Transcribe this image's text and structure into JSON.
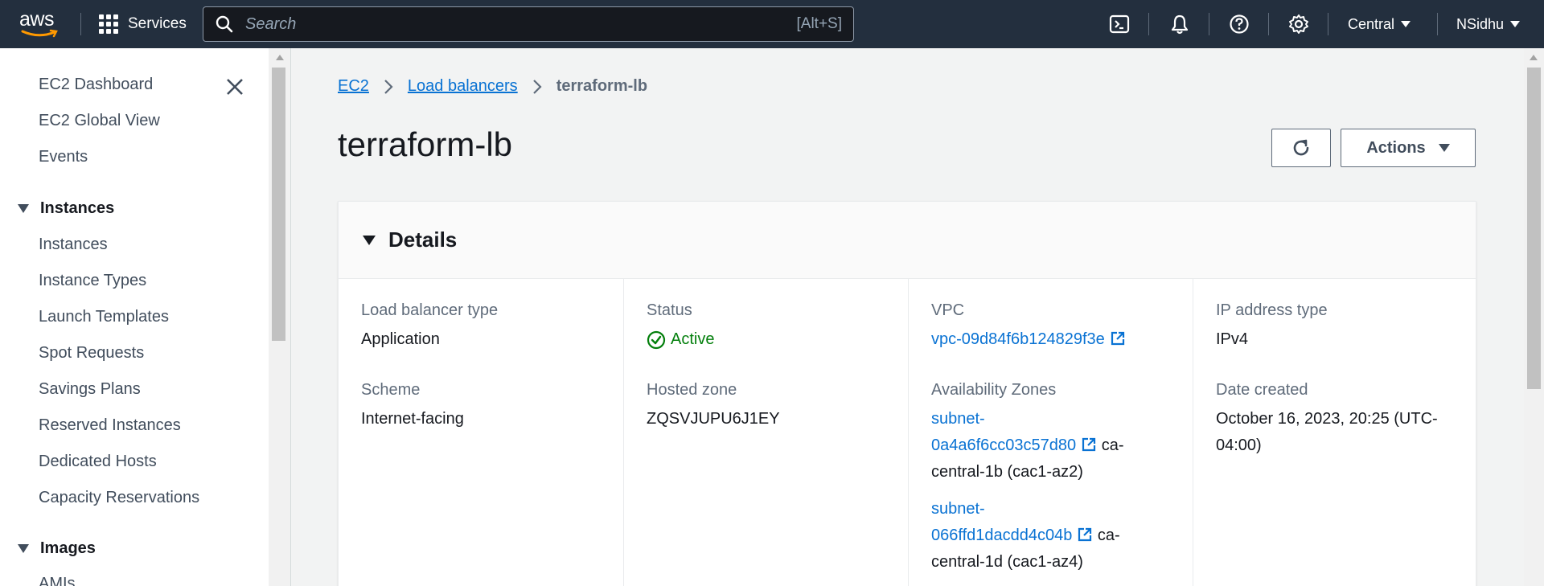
{
  "topnav": {
    "logo": "aws",
    "services_label": "Services",
    "search_placeholder": "Search",
    "search_shortcut": "[Alt+S]",
    "region": "Central",
    "user": "NSidhu"
  },
  "sidebar": {
    "items_top": [
      "EC2 Dashboard",
      "EC2 Global View",
      "Events"
    ],
    "section_instances": "Instances",
    "instances_items": [
      "Instances",
      "Instance Types",
      "Launch Templates",
      "Spot Requests",
      "Savings Plans",
      "Reserved Instances",
      "Dedicated Hosts",
      "Capacity Reservations"
    ],
    "section_images": "Images",
    "images_items": [
      "AMIs"
    ]
  },
  "breadcrumb": {
    "root": "EC2",
    "parent": "Load balancers",
    "current": "terraform-lb"
  },
  "page": {
    "title": "terraform-lb",
    "actions_label": "Actions"
  },
  "details": {
    "heading": "Details",
    "lb_type_label": "Load balancer type",
    "lb_type_value": "Application",
    "scheme_label": "Scheme",
    "scheme_value": "Internet-facing",
    "status_label": "Status",
    "status_value": "Active",
    "hosted_zone_label": "Hosted zone",
    "hosted_zone_value": "ZQSVJUPU6J1EY",
    "vpc_label": "VPC",
    "vpc_value": "vpc-09d84f6b124829f3e",
    "az_label": "Availability Zones",
    "az1_subnet_a": "subnet-",
    "az1_subnet_b": "0a4a6f6cc03c57d80",
    "az1_zone_a": "ca-",
    "az1_zone_b": "central-1b (cac1-az2)",
    "az2_subnet_a": "subnet-",
    "az2_subnet_b": "066ffd1dacdd4c04b",
    "az2_zone_a": "ca-",
    "az2_zone_b": "central-1d (cac1-az4)",
    "ip_type_label": "IP address type",
    "ip_type_value": "IPv4",
    "date_label": "Date created",
    "date_value_a": "October 16, 2023, 20:25 (UTC-",
    "date_value_b": "04:00)"
  },
  "colors": {
    "nav_bg": "#232f3e",
    "link": "#0972d3",
    "status_ok": "#037f0c"
  },
  "icons": [
    "search-icon",
    "grid-icon",
    "cloudshell-icon",
    "bell-icon",
    "help-icon",
    "settings-icon",
    "close-icon",
    "refresh-icon",
    "external-link-icon",
    "check-circle-icon"
  ]
}
